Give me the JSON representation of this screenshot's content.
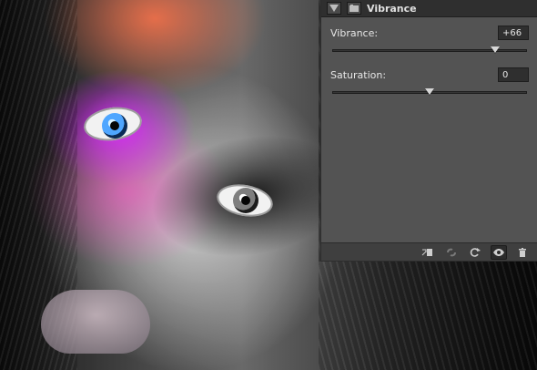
{
  "properties_panel": {
    "title": "Vibrance",
    "controls": {
      "vibrance": {
        "label": "Vibrance:",
        "value": "+66",
        "position": 0.83
      },
      "saturation": {
        "label": "Saturation:",
        "value": "0",
        "position": 0.5
      }
    },
    "bottom_icons": [
      "clip-to-layer-icon",
      "view-previous-state-icon",
      "reset-icon",
      "toggle-visibility-icon",
      "delete-icon"
    ]
  },
  "colors": {
    "panel_bg": "#535353",
    "header_bg": "#2f2f2f",
    "field_bg": "#2f2f2f",
    "text": "#e6e6e6"
  }
}
